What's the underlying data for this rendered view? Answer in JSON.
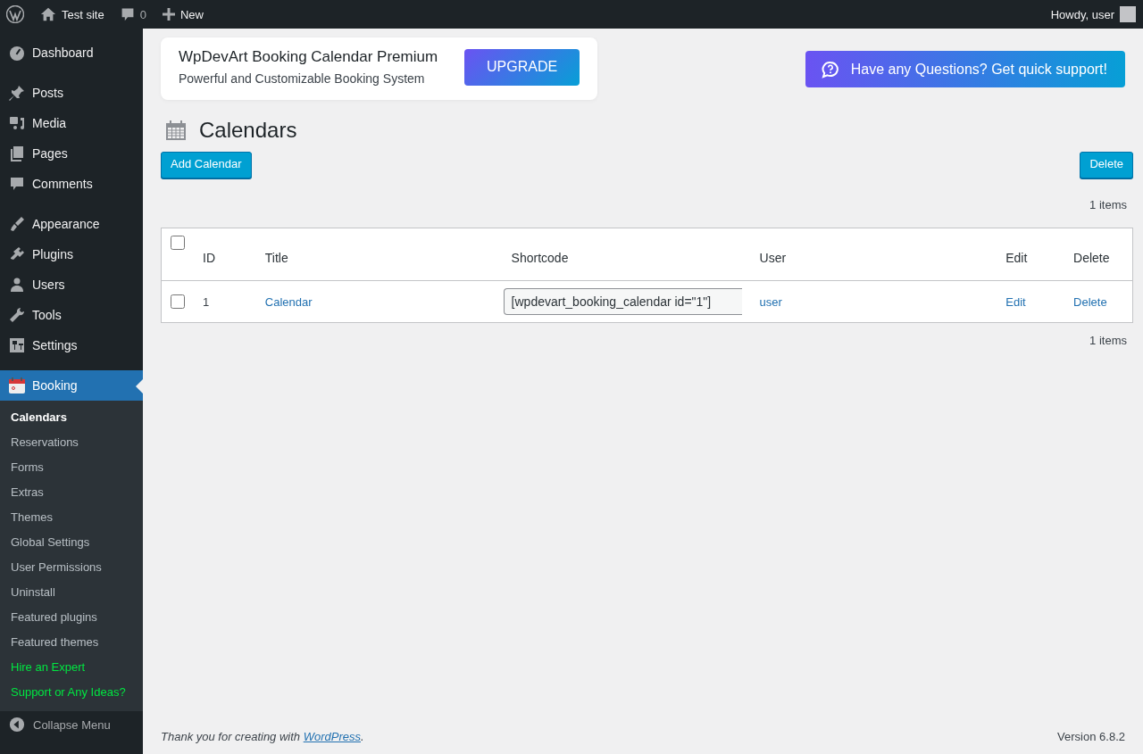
{
  "admin_bar": {
    "site": "Test site",
    "comments": "0",
    "new": "New",
    "greeting": "Howdy, user"
  },
  "sidebar": {
    "groups": [
      [
        {
          "label": "Dashboard",
          "selected": false
        }
      ],
      [
        {
          "label": "Posts",
          "selected": false
        },
        {
          "label": "Media",
          "selected": false
        },
        {
          "label": "Pages",
          "selected": false
        },
        {
          "label": "Comments",
          "selected": false
        }
      ],
      [
        {
          "label": "Appearance",
          "selected": false
        },
        {
          "label": "Plugins",
          "selected": false
        },
        {
          "label": "Users",
          "selected": false
        },
        {
          "label": "Tools",
          "selected": false
        },
        {
          "label": "Settings",
          "selected": false
        }
      ],
      [
        {
          "label": "Booking",
          "selected": true
        }
      ]
    ],
    "submenu": [
      {
        "label": "Calendars",
        "kind": "page",
        "selected": true
      },
      {
        "label": "Reservations",
        "kind": "page",
        "selected": false
      },
      {
        "label": "Forms",
        "kind": "page",
        "selected": false
      },
      {
        "label": "Extras",
        "kind": "page",
        "selected": false
      },
      {
        "label": "Themes",
        "kind": "page",
        "selected": false
      },
      {
        "label": "Global Settings",
        "kind": "page",
        "selected": false
      },
      {
        "label": "User Permissions",
        "kind": "page",
        "selected": false
      },
      {
        "label": "Uninstall",
        "kind": "page",
        "selected": false
      },
      {
        "label": "Featured plugins",
        "kind": "page",
        "selected": false
      },
      {
        "label": "Featured themes",
        "kind": "page",
        "selected": false
      },
      {
        "label": "Hire an Expert",
        "kind": "promo",
        "selected": false
      },
      {
        "label": "Support or Any Ideas?",
        "kind": "promo",
        "selected": false
      }
    ],
    "collapse": "Collapse Menu"
  },
  "banner": {
    "title": "WpDevArt Booking Calendar Premium",
    "subtitle": "Powerful and Customizable Booking System",
    "button": "UPGRADE"
  },
  "support_button": "Have any Questions? Get quick support!",
  "page_title": "Calendars",
  "add_button": "Add Calendar",
  "delete_button": "Delete",
  "items_top": "1 items",
  "table": {
    "select_all_checked": false,
    "columns": [
      "ID",
      "Title",
      "Shortcode",
      "User",
      "Edit",
      "Delete"
    ],
    "rows": [
      {
        "checked": false,
        "id": "1",
        "title": "Calendar",
        "shortcode": "[wpdevart_booking_calendar id=\"1\"]",
        "user": "user",
        "edit": "Edit",
        "delete": "Delete"
      }
    ]
  },
  "items_bottom": "1 items",
  "footer": {
    "before": "Thank you for creating with ",
    "link": "WordPress",
    "after": ".",
    "version": "Version 6.8.2"
  }
}
